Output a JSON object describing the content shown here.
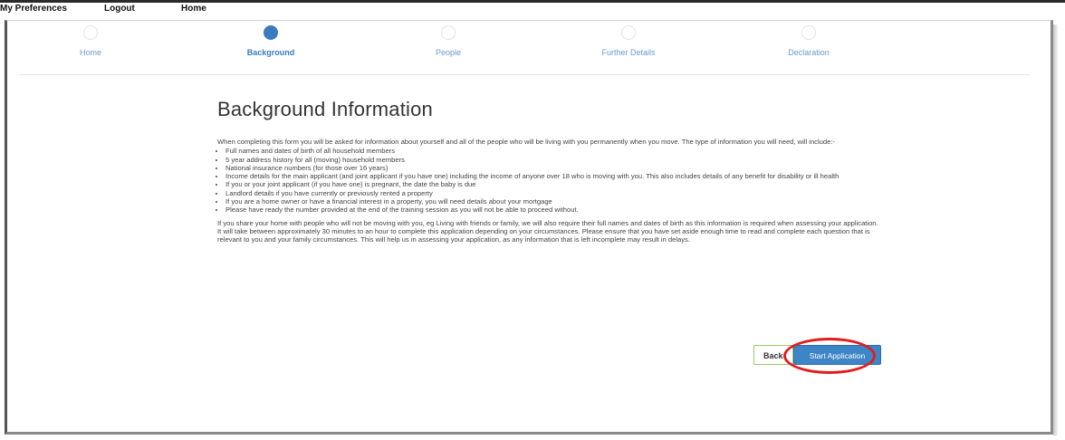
{
  "nav": {
    "preferences": "My Preferences",
    "logout": "Logout",
    "home": "Home"
  },
  "steps": [
    {
      "label": "Home",
      "active": false
    },
    {
      "label": "Background",
      "active": true
    },
    {
      "label": "People",
      "active": false
    },
    {
      "label": "Further Details",
      "active": false
    },
    {
      "label": "Declaration",
      "active": false
    }
  ],
  "page": {
    "title": "Background Information",
    "intro": "When completing this form you will be asked for information about yourself and all of the people who will be living with you permanently when you move. The type of information you will need, will include:-",
    "bullets": [
      "Full names and dates of birth of all household members",
      "5 year address history for all (moving) household members",
      "National insurance numbers (for those over 16 years)",
      "Income details for the main applicant (and joint applicant if you have one) including the income of anyone over 18 who is moving with you. This also includes details of any benefit for disability or ill health",
      "If you or your joint applicant (if you have one) is pregnant, the date the baby is due",
      "Landlord details if you have currently or previously rented a property",
      "If you are a home owner or have a financial interest in a property, you will need details about your mortgage",
      "Please have ready the number provided at the end of the training session as you will not be able to proceed without."
    ],
    "closing": "If you share your home with people who will not be moving with you, eg Living with friends or family, we will also require their full names and dates of birth as this information is required when assessing your application. It will take between approximately 30 minutes to an hour to complete this application depending on your circumstances. Please ensure that you have set aside enough time to read and complete each question that is relevant to you and your family circumstances. This will help us in assessing your application, as any information that is left incomplete may result in delays."
  },
  "actions": {
    "back": "Back",
    "start": "Start Application"
  },
  "colors": {
    "accent": "#3d85c6",
    "highlight": "#e11d1d",
    "back_border": "#9ccc65"
  }
}
